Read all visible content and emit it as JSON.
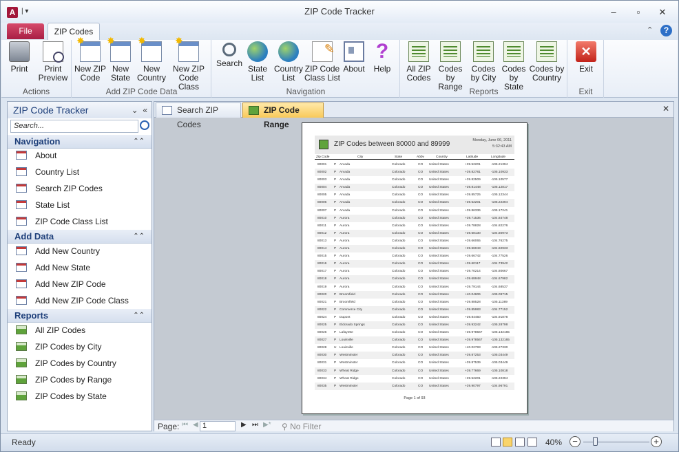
{
  "window": {
    "title": "ZIP Code Tracker",
    "app_icon": "A"
  },
  "ribbon_tabs": {
    "file": "File",
    "active": "ZIP Codes"
  },
  "ribbon": {
    "actions": {
      "label": "Actions",
      "print": "Print",
      "print_preview": [
        "Print",
        "Preview"
      ]
    },
    "add_data": {
      "label": "Add ZIP Code Data",
      "new_zip": [
        "New ZIP",
        "Code"
      ],
      "new_state": [
        "New",
        "State"
      ],
      "new_country": [
        "New",
        "Country"
      ],
      "new_zip_class": [
        "New ZIP",
        "Code Class"
      ]
    },
    "navigation": {
      "label": "Navigation",
      "search": "Search",
      "state_list": [
        "State",
        "List"
      ],
      "country_list": [
        "Country",
        "List"
      ],
      "zip_class_list": [
        "ZIP Code",
        "Class List"
      ],
      "about": "About",
      "help": "Help"
    },
    "reports": {
      "label": "Reports",
      "all_zip": [
        "All ZIP",
        "Codes"
      ],
      "by_range": [
        "Codes by",
        "Range"
      ],
      "by_city": [
        "Codes",
        "by City"
      ],
      "by_state": [
        "Codes",
        "by State"
      ],
      "by_country": [
        "Codes by",
        "Country"
      ]
    },
    "exit": {
      "label": "Exit",
      "exit": "Exit"
    }
  },
  "nav_pane": {
    "title": "ZIP Code Tracker",
    "search_placeholder": "Search...",
    "sections": {
      "navigation": {
        "title": "Navigation",
        "items": [
          "About",
          "Country List",
          "Search ZIP Codes",
          "State List",
          "ZIP Code Class List"
        ]
      },
      "add_data": {
        "title": "Add Data",
        "items": [
          "Add New Country",
          "Add New State",
          "Add New ZIP Code",
          "Add New ZIP Code Class"
        ]
      },
      "reports": {
        "title": "Reports",
        "items": [
          "All ZIP Codes",
          "ZIP Codes by City",
          "ZIP Codes by Country",
          "ZIP Codes by Range",
          "ZIP Codes by State"
        ]
      }
    }
  },
  "doc_tabs": [
    "Search ZIP Codes",
    "ZIP Code Range"
  ],
  "report": {
    "title": "ZIP Codes between 80000 and 89999",
    "date": "Monday, June 06, 2011",
    "time": "5:32:43 AM",
    "columns": [
      "Zip Code",
      "City",
      "State",
      "Abbv",
      "Country",
      "Latitude",
      "Longitude"
    ],
    "rows": [
      [
        "80001",
        "P",
        "Arvada",
        "Colorado",
        "CO",
        "United States",
        "+39.52201",
        "-105.21394"
      ],
      [
        "80002",
        "P",
        "Arvada",
        "Colorado",
        "CO",
        "United States",
        "+39.82781",
        "-105.10933"
      ],
      [
        "80003",
        "P",
        "Arvada",
        "Colorado",
        "CO",
        "United States",
        "+39.82509",
        "-105.10577"
      ],
      [
        "80004",
        "P",
        "Arvada",
        "Colorado",
        "CO",
        "United States",
        "+39.81448",
        "-105.12817"
      ],
      [
        "80005",
        "P",
        "Arvada",
        "Colorado",
        "CO",
        "United States",
        "+39.85725",
        "-105.12344"
      ],
      [
        "80006",
        "P",
        "Arvada",
        "Colorado",
        "CO",
        "United States",
        "+39.52201",
        "-105.22394"
      ],
      [
        "80007",
        "P",
        "Arvada",
        "Colorado",
        "CO",
        "United States",
        "+39.86336",
        "-105.17241"
      ],
      [
        "80010",
        "P",
        "Aurora",
        "Colorado",
        "CO",
        "United States",
        "+39.71536",
        "-104.84748"
      ],
      [
        "80011",
        "P",
        "Aurora",
        "Colorado",
        "CO",
        "United States",
        "+39.78828",
        "-104.82276"
      ],
      [
        "80012",
        "P",
        "Aurora",
        "Colorado",
        "CO",
        "United States",
        "+39.68130",
        "-104.80973"
      ],
      [
        "80013",
        "P",
        "Aurora",
        "Colorado",
        "CO",
        "United States",
        "+39.66065",
        "-104.76275"
      ],
      [
        "80014",
        "P",
        "Aurora",
        "Colorado",
        "CO",
        "United States",
        "+39.66043",
        "-104.82933"
      ],
      [
        "80015",
        "P",
        "Aurora",
        "Colorado",
        "CO",
        "United States",
        "+39.66742",
        "-104.77526"
      ],
      [
        "80016",
        "P",
        "Aurora",
        "Colorado",
        "CO",
        "United States",
        "+39.60117",
        "-104.73942"
      ],
      [
        "80017",
        "P",
        "Aurora",
        "Colorado",
        "CO",
        "United States",
        "+39.70214",
        "-104.80667"
      ],
      [
        "80018",
        "P",
        "Aurora",
        "Colorado",
        "CO",
        "United States",
        "+39.68948",
        "-104.67982"
      ],
      [
        "80019",
        "P",
        "Aurora",
        "Colorado",
        "CO",
        "United States",
        "+39.79144",
        "-104.68537"
      ],
      [
        "80020",
        "P",
        "Broomfield",
        "Colorado",
        "CO",
        "United States",
        "+40.04606",
        "-105.09715"
      ],
      [
        "80021",
        "P",
        "Broomfield",
        "Colorado",
        "CO",
        "United States",
        "+39.88528",
        "-105.11389"
      ],
      [
        "80022",
        "P",
        "Commerce City",
        "Colorado",
        "CO",
        "United States",
        "+39.85983",
        "-104.77152"
      ],
      [
        "80024",
        "P",
        "Dupont",
        "Colorado",
        "CO",
        "United States",
        "+39.84450",
        "-104.91878"
      ],
      [
        "80025",
        "P",
        "Eldorado Springs",
        "Colorado",
        "CO",
        "United States",
        "+39.93242",
        "-105.28798"
      ],
      [
        "80026",
        "P",
        "Lafayette",
        "Colorado",
        "CO",
        "United States",
        "+39.978567",
        "-105.132165"
      ],
      [
        "80027",
        "P",
        "Louisville",
        "Colorado",
        "CO",
        "United States",
        "+39.978567",
        "-105.132165"
      ],
      [
        "80028",
        "U",
        "Louisville",
        "Colorado",
        "CO",
        "United States",
        "+40.02783",
        "-105.27330"
      ],
      [
        "80030",
        "P",
        "Westminster",
        "Colorado",
        "CO",
        "United States",
        "+39.87253",
        "-105.03449"
      ],
      [
        "80031",
        "P",
        "Westminster",
        "Colorado",
        "CO",
        "United States",
        "+39.87539",
        "-105.03449"
      ],
      [
        "80033",
        "P",
        "Wheat Ridge",
        "Colorado",
        "CO",
        "United States",
        "+39.77669",
        "-105.10818"
      ],
      [
        "80034",
        "P",
        "Wheat Ridge",
        "Colorado",
        "CO",
        "United States",
        "+39.52201",
        "-105.22394"
      ],
      [
        "80035",
        "P",
        "Westminster",
        "Colorado",
        "CO",
        "United States",
        "+39.90797",
        "-104.96791"
      ]
    ],
    "footer": "Page 1 of 93"
  },
  "record_nav": {
    "label": "Page:",
    "value": "1",
    "filter": "No Filter"
  },
  "status": {
    "text": "Ready",
    "zoom": "40%"
  }
}
